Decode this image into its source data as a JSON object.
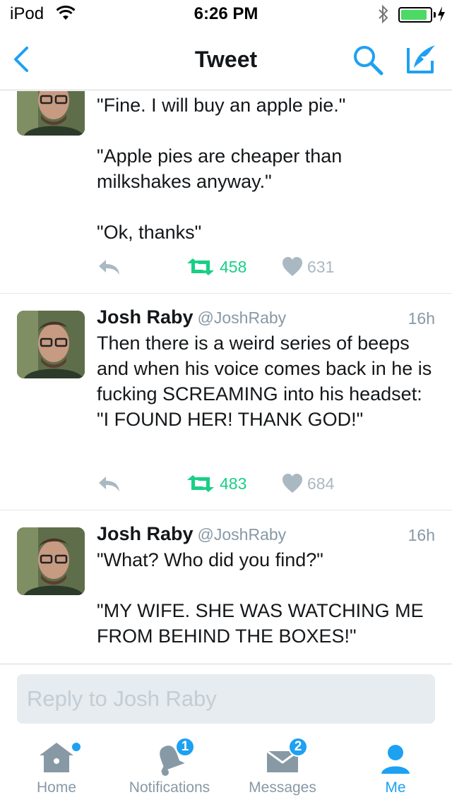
{
  "status_bar": {
    "carrier": "iPod",
    "time": "6:26 PM",
    "battery_level": 0.9
  },
  "nav": {
    "title": "Tweet",
    "back_icon": "chevron-left-icon",
    "search_icon": "search-icon",
    "compose_icon": "compose-tweet-icon"
  },
  "colors": {
    "accent": "#1da1f2",
    "retweet": "#19cf86",
    "muted": "#8899a6"
  },
  "tweets": [
    {
      "name": "",
      "handle": "",
      "time": "",
      "text": "\"Fine. I will buy an apple pie.\"\n\n\"Apple pies are cheaper than milkshakes anyway.\"\n\n\"Ok, thanks\"",
      "retweets": "458",
      "likes": "631"
    },
    {
      "name": "Josh Raby",
      "handle": "@JoshRaby",
      "time": "16h",
      "text": "Then there is a weird series of beeps and when his voice comes back in he is fucking SCREAMING into his headset:\n\"I FOUND HER! THANK GOD!\"",
      "retweets": "483",
      "likes": "684"
    },
    {
      "name": "Josh Raby",
      "handle": "@JoshRaby",
      "time": "16h",
      "text": "\"What? Who did you find?\"\n\n\"MY WIFE. SHE WAS WATCHING ME FROM BEHIND THE BOXES!\"",
      "retweets": "",
      "likes": ""
    }
  ],
  "reply": {
    "placeholder": "Reply to Josh Raby"
  },
  "tabs": [
    {
      "label": "Home",
      "icon": "home-icon",
      "badge": ""
    },
    {
      "label": "Notifications",
      "icon": "bell-icon",
      "badge": "1"
    },
    {
      "label": "Messages",
      "icon": "envelope-icon",
      "badge": "2"
    },
    {
      "label": "Me",
      "icon": "profile-icon",
      "badge": ""
    }
  ]
}
